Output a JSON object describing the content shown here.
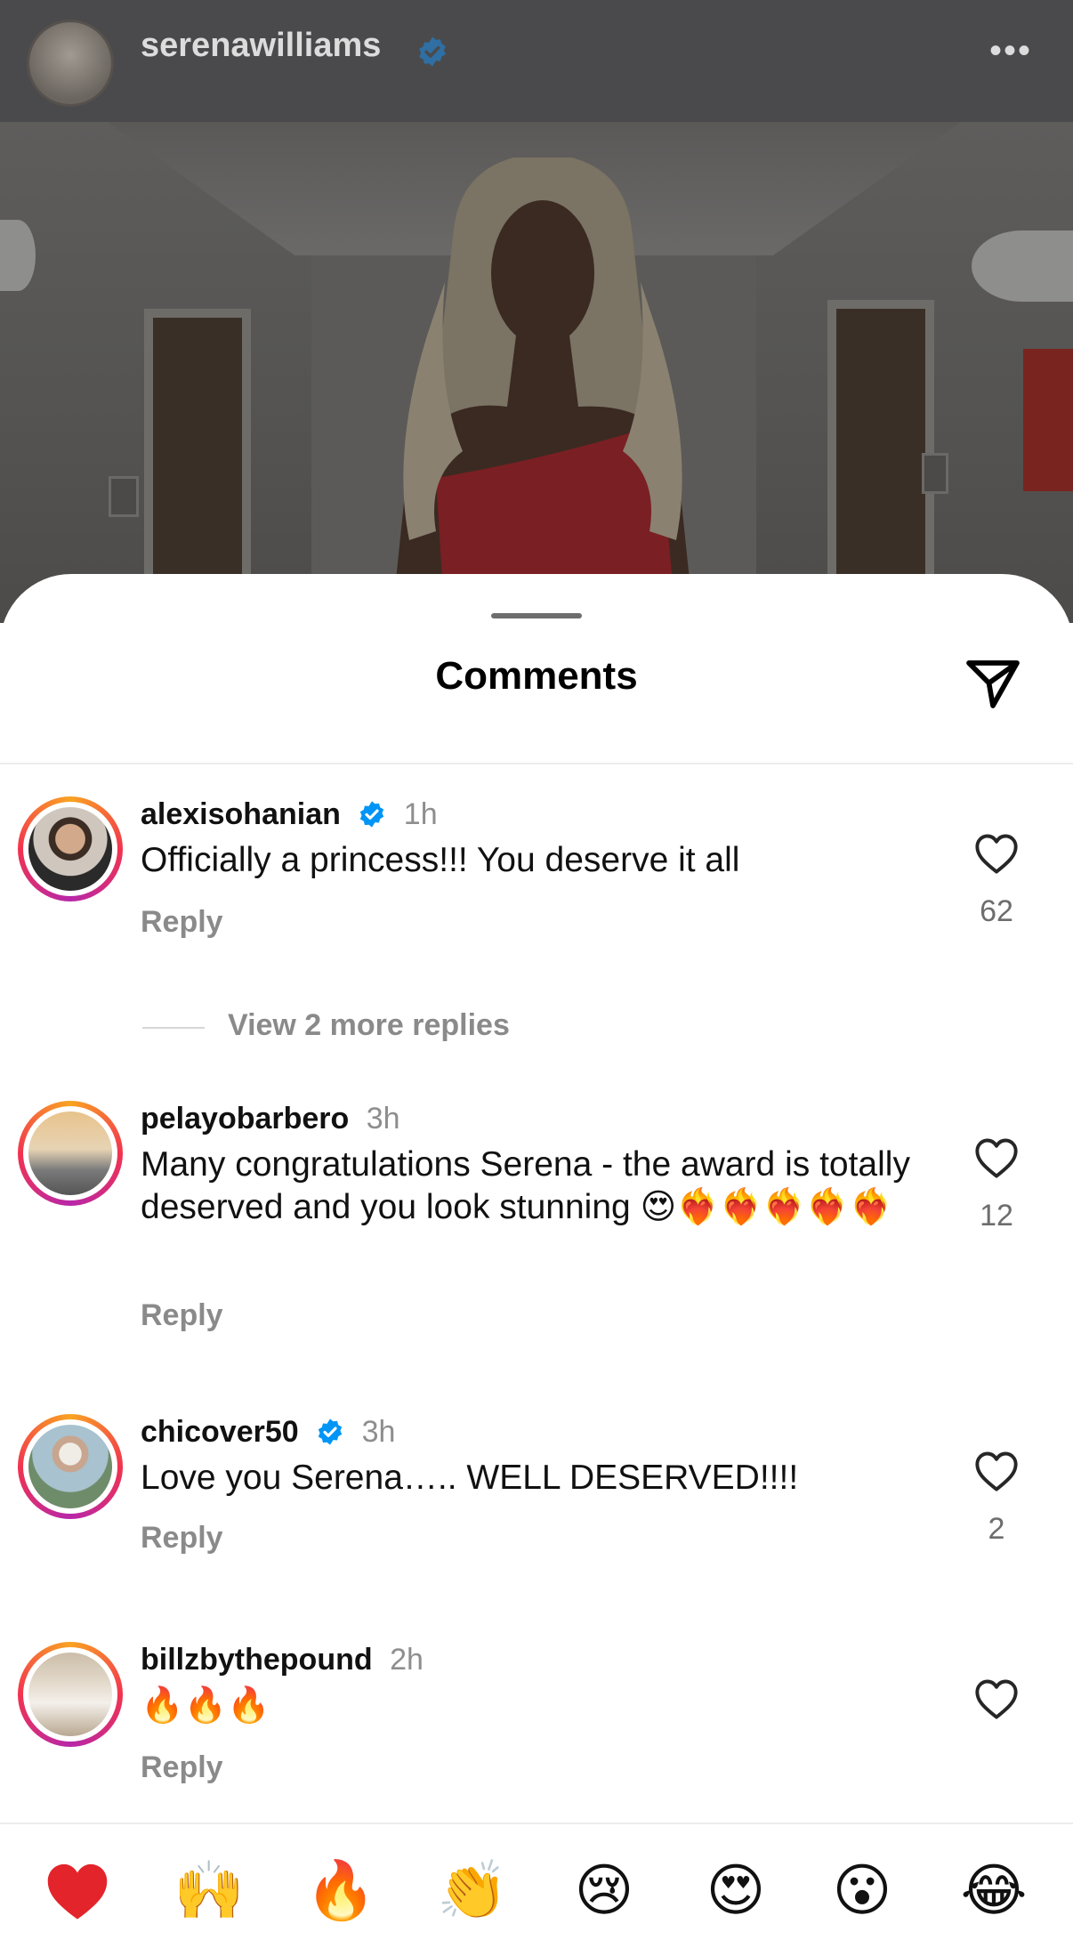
{
  "post": {
    "username": "serenawilliams",
    "more_label": "•••",
    "icons": {
      "verified": "verified-badge-icon",
      "more": "more-options-icon"
    }
  },
  "sheet": {
    "title": "Comments",
    "share_icon": "send-icon"
  },
  "comments": [
    {
      "username": "alexisohanian",
      "verified": true,
      "time": "1h",
      "text": "Officially a princess!!! You deserve it all",
      "reply_label": "Reply",
      "likes": "62",
      "view_replies": "View 2 more replies"
    },
    {
      "username": "pelayobarbero",
      "verified": false,
      "time": "3h",
      "text": "Many congratulations Serena - the award is totally deserved and you look stunning 😍❤️‍🔥❤️‍🔥❤️‍🔥❤️‍🔥❤️‍🔥",
      "reply_label": "Reply",
      "likes": "12"
    },
    {
      "username": "chicover50",
      "verified": true,
      "time": "3h",
      "text": "Love you Serena….. WELL DESERVED!!!!",
      "reply_label": "Reply",
      "likes": "2"
    },
    {
      "username": "billzbythepound",
      "verified": false,
      "time": "2h",
      "text": "🔥🔥🔥",
      "reply_label": "Reply",
      "likes": ""
    }
  ],
  "emoji_bar": [
    {
      "name": "red-heart",
      "glyph": "❤️"
    },
    {
      "name": "raising-hands",
      "glyph": "🙌"
    },
    {
      "name": "fire",
      "glyph": "🔥"
    },
    {
      "name": "clapping-hands",
      "glyph": "👏"
    },
    {
      "name": "crying-face",
      "glyph": "😢"
    },
    {
      "name": "heart-eyes",
      "glyph": "😍"
    },
    {
      "name": "open-mouth-face",
      "glyph": "😮"
    },
    {
      "name": "tears-of-joy",
      "glyph": "😂"
    }
  ],
  "colors": {
    "verified_blue": "#0095f6",
    "story_ring": [
      "#f9a322",
      "#f2334f",
      "#b727a9"
    ],
    "secondary_text": "#8a8a8a"
  }
}
